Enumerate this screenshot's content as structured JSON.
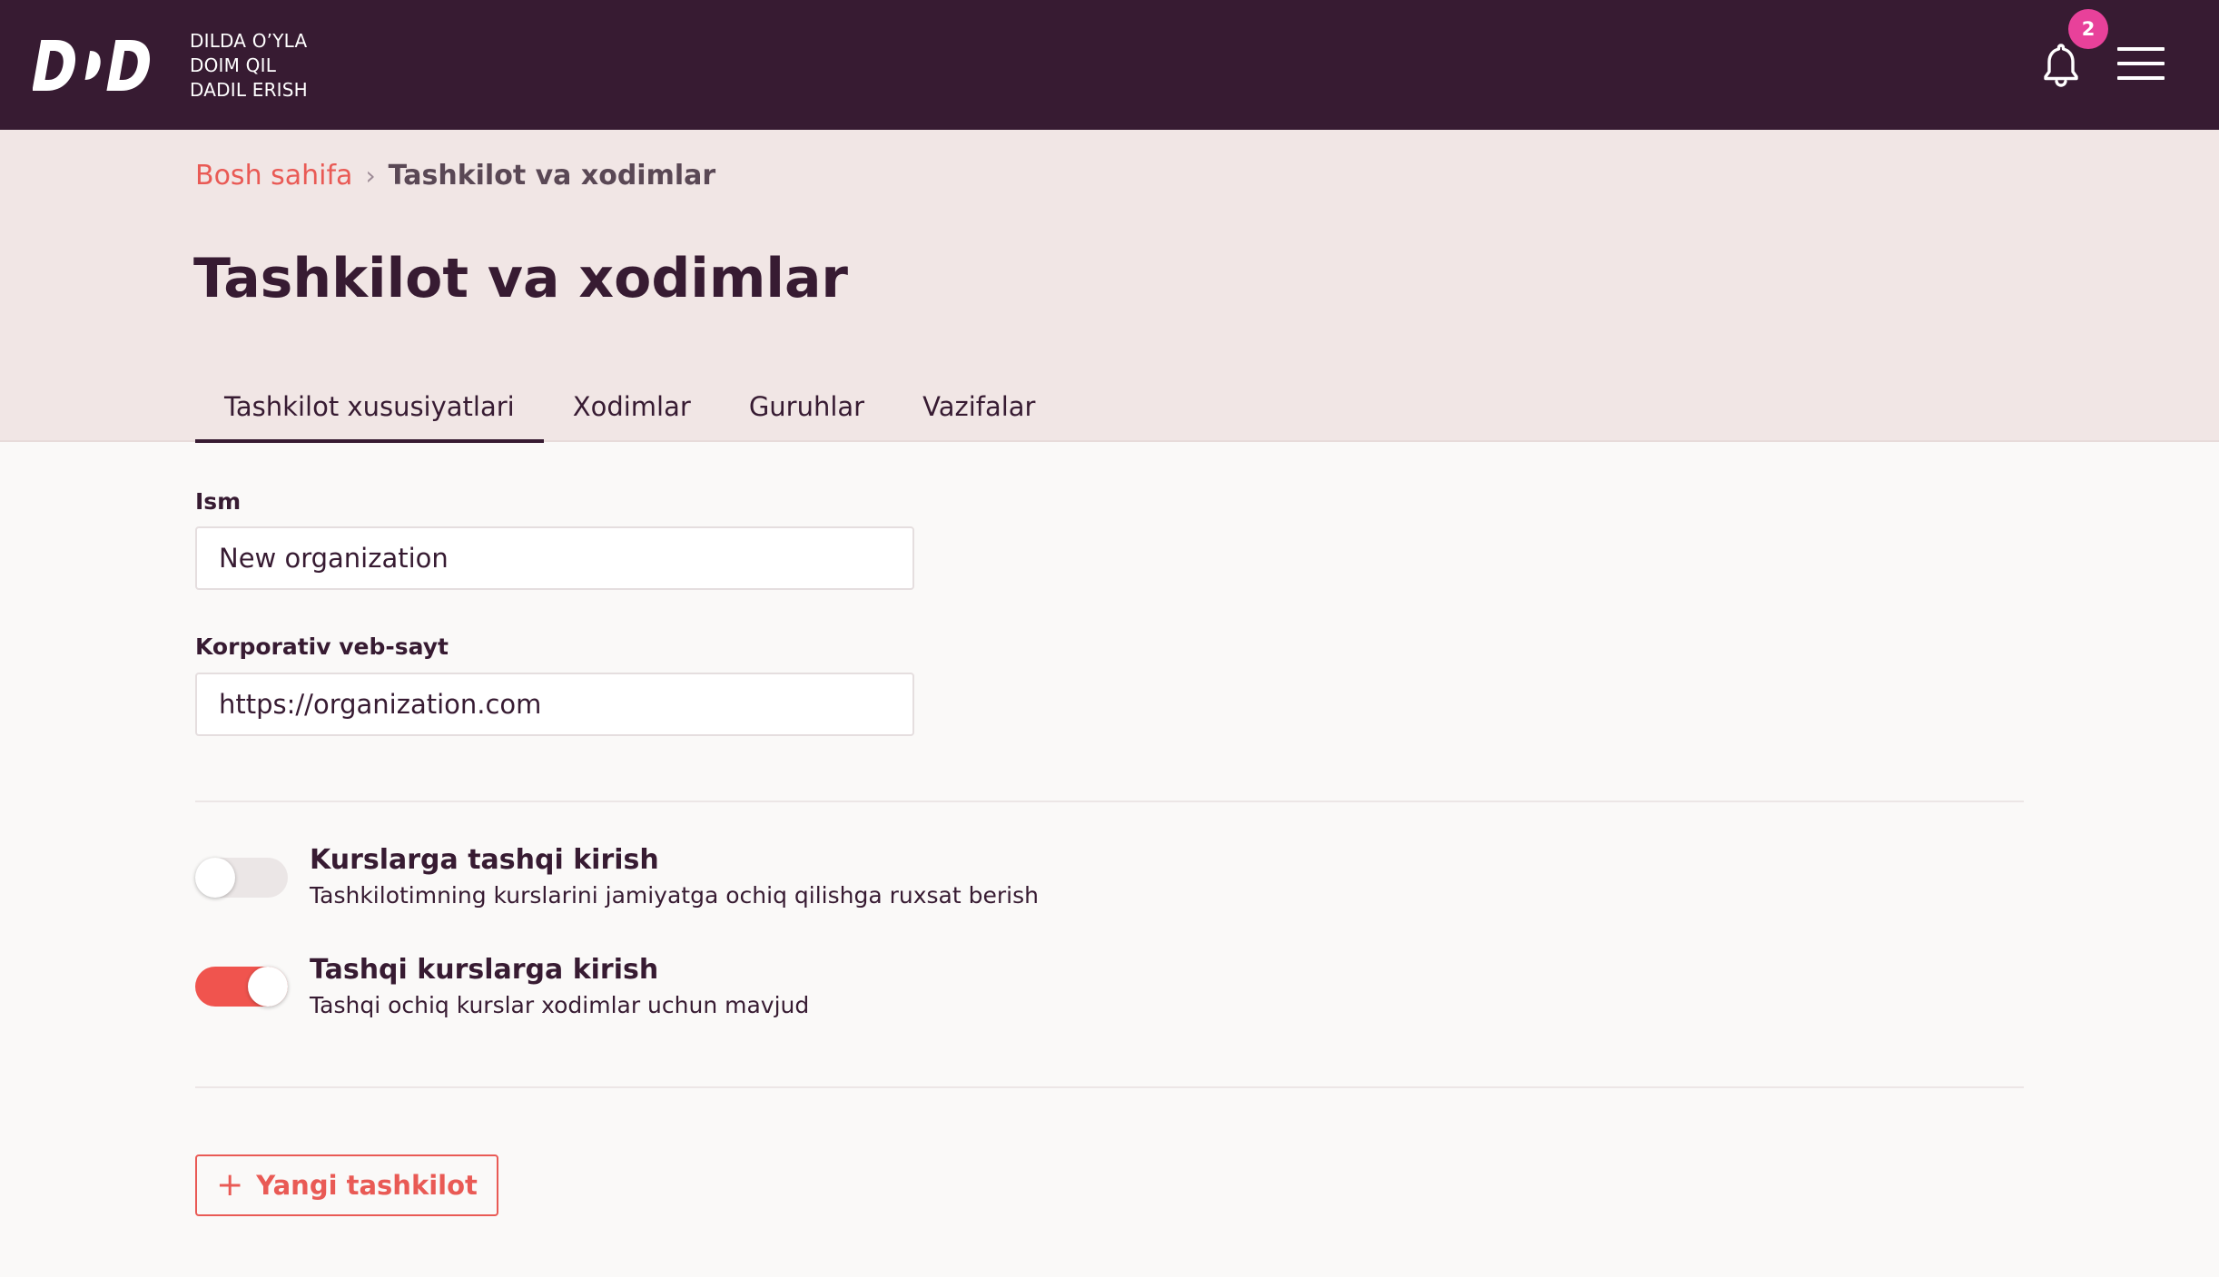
{
  "header": {
    "logo_text": "DDD",
    "tagline": [
      "DILDA O’YLA",
      "DOIM QIL",
      "DADIL ERISH"
    ],
    "notification_count": "2",
    "icons": {
      "bell": "bell-icon",
      "menu": "hamburger-menu-icon"
    }
  },
  "breadcrumb": {
    "home": "Bosh sahifa",
    "separator": "›",
    "current": "Tashkilot va xodimlar"
  },
  "page_title": "Tashkilot va xodimlar",
  "tabs": [
    {
      "label": "Tashkilot xususiyatlari",
      "active": true
    },
    {
      "label": "Xodimlar",
      "active": false
    },
    {
      "label": "Guruhlar",
      "active": false
    },
    {
      "label": "Vazifalar",
      "active": false
    }
  ],
  "form": {
    "name_label": "Ism",
    "name_value": "New organization",
    "website_label": "Korporativ veb-sayt",
    "website_value": "https://organization.com"
  },
  "options": [
    {
      "title": "Kurslarga tashqi kirish",
      "description": "Tashkilotimning kurslarini jamiyatga ochiq qilishga ruxsat berish",
      "enabled": false
    },
    {
      "title": "Tashqi kurslarga kirish",
      "description": "Tashqi ochiq kurslar xodimlar uchun mavjud",
      "enabled": true
    }
  ],
  "new_org_button": {
    "icon": "plus-icon",
    "label": "Yangi tashkilot"
  },
  "colors": {
    "header_bg": "#371b32",
    "band_bg": "#f1e6e5",
    "accent": "#e95a55",
    "badge": "#e8419a",
    "toggle_on": "#f0544e"
  }
}
